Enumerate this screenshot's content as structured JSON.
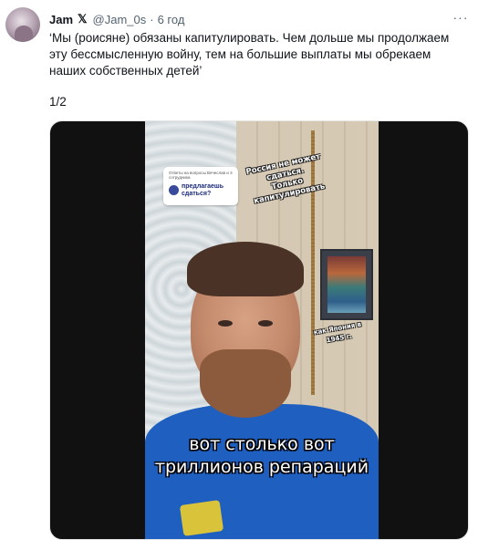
{
  "tweet": {
    "author_name": "Jam",
    "x_icon": "x-logo-icon",
    "handle": "@Jam_0s",
    "separator": "·",
    "time": "6 год",
    "more_icon": "more-options-icon",
    "text": "‘Мы (роисяне) обязаны капитулировать. Чем дольше мы продолжаем\nэту бессмысленную войну, тем на большие выплаты мы обрекаем\nнаших собственных детей’",
    "counter": "1/2"
  },
  "video": {
    "question_small": "Ответы на вопросы Вячеслав и 3 сотрудника",
    "question_big": "предлагаешь сдаться?",
    "sticker_top": "Россия не может\nсдаться.\nТолько\nкапитулировать",
    "sticker_side": "как Япония в\n1945 г.",
    "subtitle": "вот столько вот\nтриллионов репараций"
  }
}
